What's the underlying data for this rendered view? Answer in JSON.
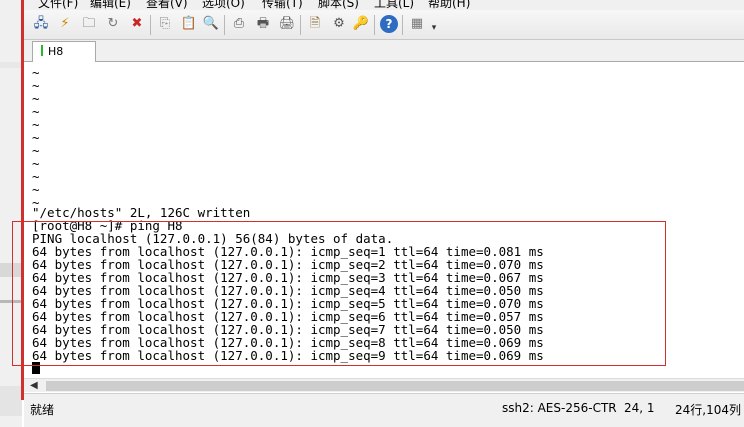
{
  "menu": {
    "items": [
      "文件(F)",
      "编辑(E)",
      "查看(V)",
      "选项(O)",
      "传输(T)",
      "脚本(S)",
      "工具(L)",
      "帮助(H)"
    ]
  },
  "toolbar": {
    "buttons": [
      {
        "name": "connect-icon",
        "glyph": "🖧"
      },
      {
        "name": "quick-connect-icon",
        "glyph": "⚡"
      },
      {
        "name": "connect-in-tab-icon",
        "glyph": "🗀"
      },
      {
        "name": "reconnect-icon",
        "glyph": "↻"
      },
      {
        "name": "disconnect-icon",
        "glyph": "✖"
      },
      {
        "name": "copy-icon",
        "glyph": "⎘"
      },
      {
        "name": "paste-icon",
        "glyph": "📋"
      },
      {
        "name": "find-icon",
        "glyph": "🔍"
      },
      {
        "name": "print-setup-icon",
        "glyph": "⎙"
      },
      {
        "name": "print-preview-icon",
        "glyph": "🖶"
      },
      {
        "name": "print-icon",
        "glyph": "🖨"
      },
      {
        "name": "session-options-icon",
        "glyph": "🗎"
      },
      {
        "name": "global-options-icon",
        "glyph": "⚙"
      },
      {
        "name": "keymap-icon",
        "glyph": "🔑"
      },
      {
        "name": "help-icon",
        "glyph": "?"
      },
      {
        "name": "sftp-icon",
        "glyph": "▦"
      },
      {
        "name": "toolbar-overflow-icon",
        "glyph": "▾"
      }
    ]
  },
  "tab": {
    "label": "H8"
  },
  "terminal": {
    "lines": [
      "~",
      "~",
      "~",
      "~",
      "~",
      "~",
      "~",
      "~",
      "~",
      "~",
      "~",
      "\"/etc/hosts\" 2L, 126C written",
      "[root@H8 ~]# ping H8",
      "PING localhost (127.0.0.1) 56(84) bytes of data.",
      "64 bytes from localhost (127.0.0.1): icmp_seq=1 ttl=64 time=0.081 ms",
      "64 bytes from localhost (127.0.0.1): icmp_seq=2 ttl=64 time=0.070 ms",
      "64 bytes from localhost (127.0.0.1): icmp_seq=3 ttl=64 time=0.067 ms",
      "64 bytes from localhost (127.0.0.1): icmp_seq=4 ttl=64 time=0.050 ms",
      "64 bytes from localhost (127.0.0.1): icmp_seq=5 ttl=64 time=0.070 ms",
      "64 bytes from localhost (127.0.0.1): icmp_seq=6 ttl=64 time=0.057 ms",
      "64 bytes from localhost (127.0.0.1): icmp_seq=7 ttl=64 time=0.050 ms",
      "64 bytes from localhost (127.0.0.1): icmp_seq=8 ttl=64 time=0.069 ms",
      "64 bytes from localhost (127.0.0.1): icmp_seq=9 ttl=64 time=0.069 ms"
    ]
  },
  "statusbar": {
    "ready": "就绪",
    "encryption": "ssh2: AES-256-CTR",
    "cursor_pos": "24,  1",
    "size": "24行,104列"
  },
  "colors": {
    "highlight": "#d32f2f",
    "tab_marker": "#29b829"
  }
}
